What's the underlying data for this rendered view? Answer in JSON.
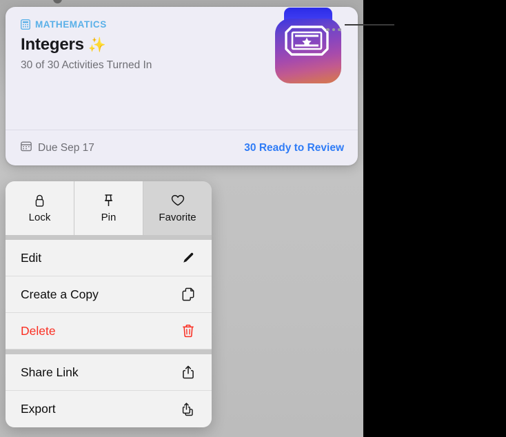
{
  "card": {
    "subject": "MATHEMATICS",
    "subject_icon": "calculator-icon",
    "title": "Integers",
    "title_emoji": "✨",
    "subtitle": "30 of 30 Activities Turned In",
    "more_icon": "ellipsis-icon",
    "footer": {
      "due_icon": "calendar-icon",
      "due_text": "Due Sep 17",
      "review_link": "30 Ready to Review"
    },
    "artwork_icon": "ticket-badge-app-icon",
    "colors": {
      "subject": "#59b0e8",
      "link": "#2f7cf6",
      "card_bg": "#eeedf6"
    }
  },
  "context_menu": {
    "quick_actions": [
      {
        "label": "Lock",
        "icon": "lock-icon",
        "pressed": false
      },
      {
        "label": "Pin",
        "icon": "pin-icon",
        "pressed": false
      },
      {
        "label": "Favorite",
        "icon": "heart-icon",
        "pressed": true
      }
    ],
    "items": [
      {
        "label": "Edit",
        "icon": "pencil-icon",
        "destructive": false
      },
      {
        "label": "Create a Copy",
        "icon": "duplicate-icon",
        "destructive": false
      },
      {
        "label": "Delete",
        "icon": "trash-icon",
        "destructive": true
      },
      {
        "label": "Share Link",
        "icon": "share-icon",
        "destructive": false
      },
      {
        "label": "Export",
        "icon": "export-icon",
        "destructive": false
      }
    ],
    "colors": {
      "destructive": "#fa2f23"
    }
  }
}
